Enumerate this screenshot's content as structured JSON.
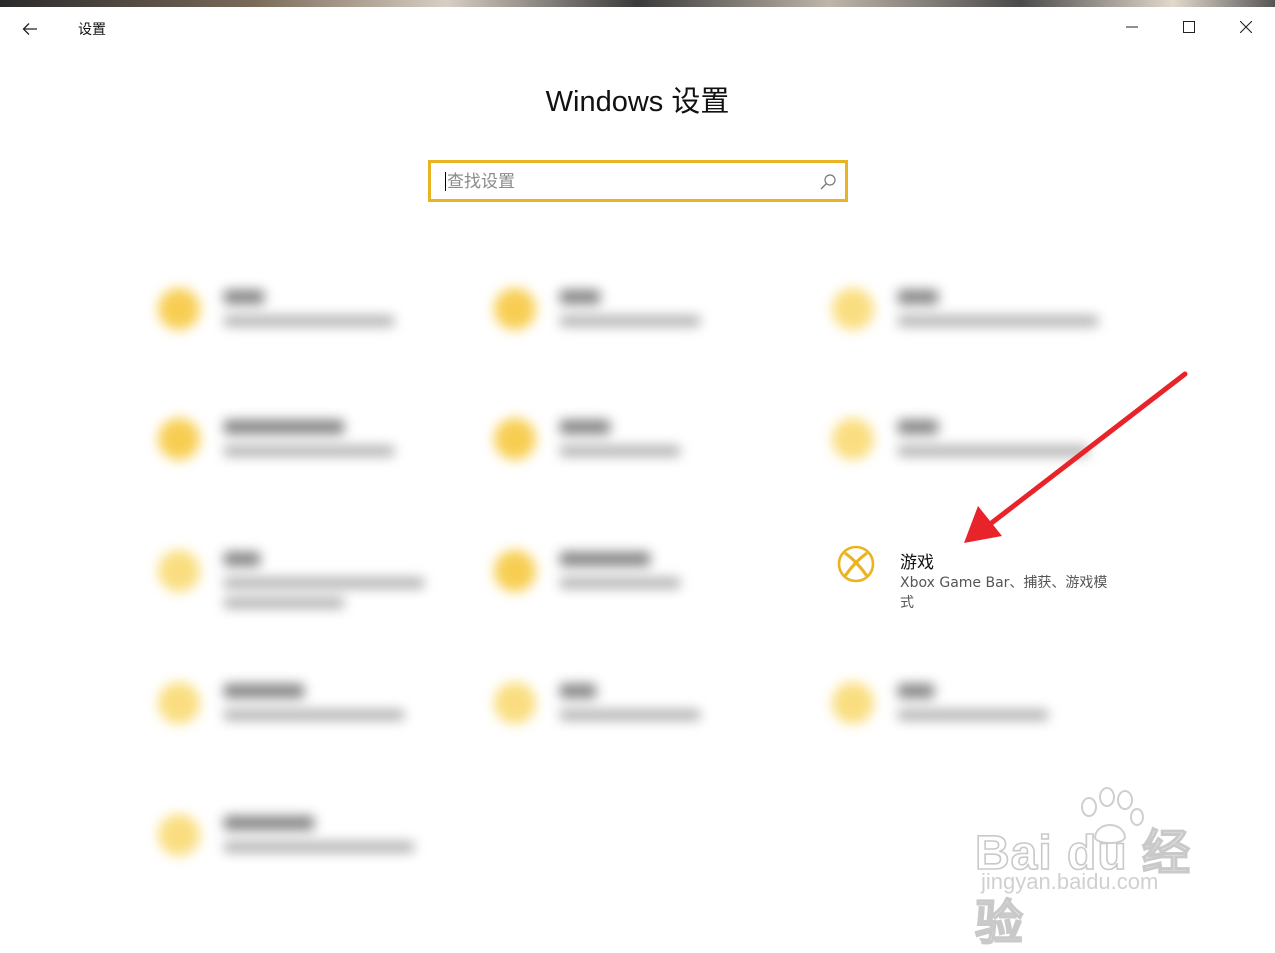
{
  "window": {
    "title": "设置",
    "controls": {
      "minimize": "minimize-icon",
      "maximize": "maximize-icon",
      "close": "close-icon"
    }
  },
  "page": {
    "heading": "Windows 设置"
  },
  "search": {
    "placeholder": "查找设置"
  },
  "featured": {
    "title": "游戏",
    "description": "Xbox Game Bar、捕获、游戏模式",
    "icon": "xbox-icon"
  },
  "colors": {
    "accent": "#e8b424",
    "icon_yellow": "#f6c635",
    "arrow_red": "#e8232a"
  }
}
